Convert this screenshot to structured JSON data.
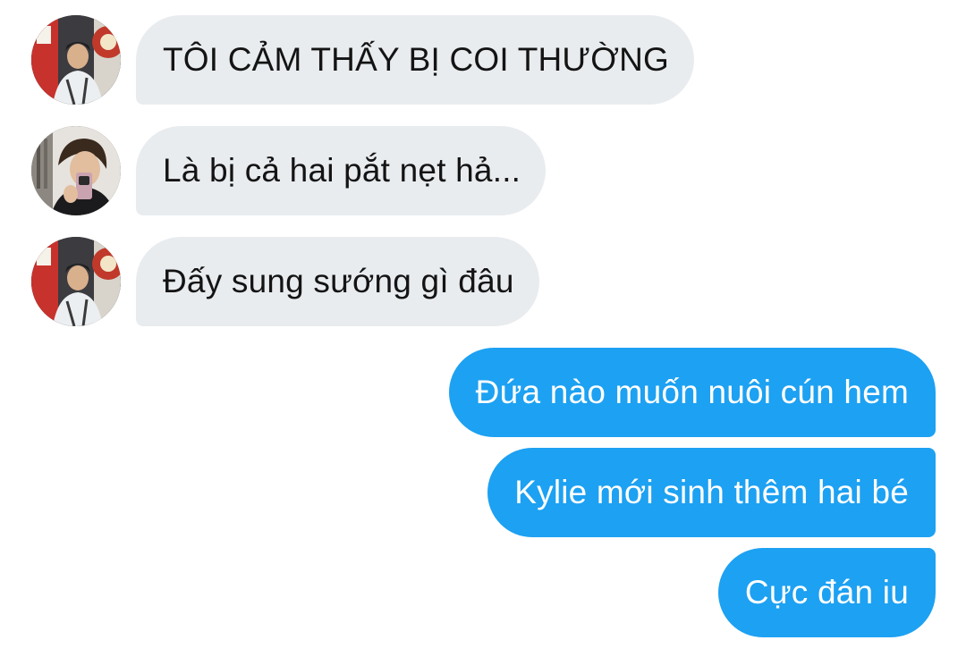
{
  "conversation": {
    "incoming": [
      {
        "text": "TÔI CẢM THẤY BỊ COI THƯỜNG",
        "avatar": "sender-avatar-photo-a"
      },
      {
        "text": "Là bị cả hai pắt nẹt hả...",
        "avatar": "sender-avatar-photo-b"
      },
      {
        "text": "Đấy sung sướng gì đâu",
        "avatar": "sender-avatar-photo-a"
      }
    ],
    "outgoing": [
      {
        "text": "Đứa nào muốn nuôi cún hem"
      },
      {
        "text": "Kylie mới sinh thêm hai bé"
      },
      {
        "text": "Cực đán iu"
      }
    ]
  },
  "colors": {
    "incoming_bubble": "#e9ecef",
    "incoming_text": "#141414",
    "outgoing_bubble": "#1da1f2",
    "outgoing_text": "#ffffff",
    "background": "#ffffff"
  }
}
